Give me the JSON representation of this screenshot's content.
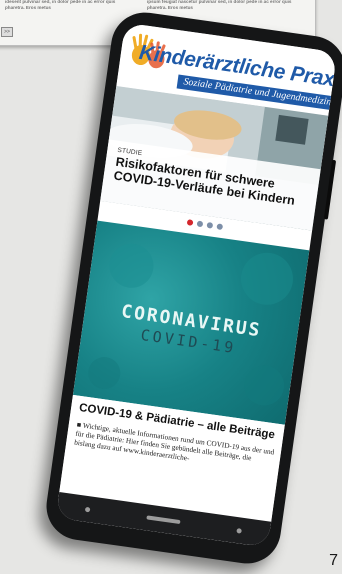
{
  "background_page": {
    "text_left": "idesent pulvinar sed, in dolor pede in ac error quis pharetra. Eros metus",
    "text_right": "ipsum feugiat nascetur pulvinar sed, in dolor pede in ac error quis pharetra. Eros metus",
    "nav_button": ">>",
    "page_number": "7"
  },
  "site": {
    "brand": "Kinderärztliche Praxis",
    "subtitle": "Soziale Pädiatrie und Jugendmedizin",
    "colors": {
      "brand_blue": "#1f5aa8",
      "accent_red": "#d4262c",
      "teal": "#178286"
    }
  },
  "slider": {
    "kicker": "STUDIE",
    "title": "Risikofaktoren für schwere COVID-19-Verläufe bei Kindern",
    "active_index": 0,
    "dot_count": 4
  },
  "feature": {
    "image_title": "CORONAVIRUS",
    "image_subtitle": "COVID-19",
    "headline": "COVID-19 & Pädiatrie – alle Beiträge",
    "teaser": "■ Wichtige, aktuelle Informationen rund um COVID-19 aus der und für die Pädiatrie: Hier finden Sie gebündelt alle Beiträge, die bislang dazu auf www.kinderaerztliche-"
  }
}
